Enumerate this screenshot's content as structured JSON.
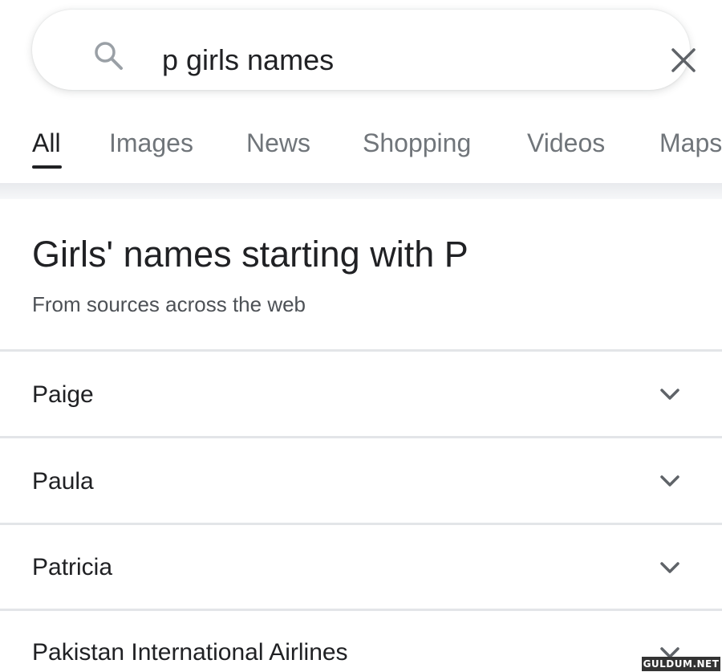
{
  "search": {
    "query": "p girls names"
  },
  "tabs": [
    {
      "label": "All"
    },
    {
      "label": "Images"
    },
    {
      "label": "News"
    },
    {
      "label": "Shopping"
    },
    {
      "label": "Videos"
    },
    {
      "label": "Maps"
    }
  ],
  "result": {
    "heading": "Girls' names starting with P",
    "subtext": "From sources across the web",
    "items": [
      {
        "label": "Paige"
      },
      {
        "label": "Paula"
      },
      {
        "label": "Patricia"
      },
      {
        "label": "Pakistan International Airlines"
      }
    ]
  },
  "watermark": "GULDUM.NET",
  "icons": {
    "search": "search-icon",
    "clear": "close-icon",
    "expand": "chevron-down-icon"
  }
}
